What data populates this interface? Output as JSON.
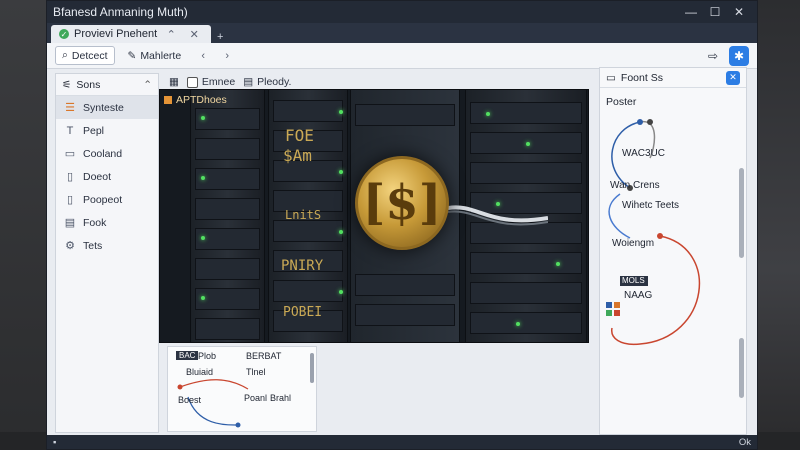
{
  "window": {
    "title": "Bfanesd Anmaning Muth)",
    "controls": [
      "—",
      "☐",
      "✕"
    ]
  },
  "tab": {
    "label": "Provievi Pnehent",
    "status_color": "#3fa85a"
  },
  "toolbar": {
    "btn1": "Detcect",
    "btn2": "Mahlerte"
  },
  "sidebar": {
    "header": "Sons",
    "items": [
      {
        "label": "Synteste",
        "icon": "list-icon"
      },
      {
        "label": "Pepl",
        "icon": "text-icon"
      },
      {
        "label": "Cooland",
        "icon": "box-icon"
      },
      {
        "label": "Doeot",
        "icon": "doc-icon"
      },
      {
        "label": "Poopeot",
        "icon": "doc-icon"
      },
      {
        "label": "Fook",
        "icon": "table-icon"
      },
      {
        "label": "Tets",
        "icon": "gear-icon"
      }
    ]
  },
  "center": {
    "tool1": "Emnee",
    "tool2": "Pleody.",
    "preview_label": "APTDhoes",
    "rack_texts": [
      "FOE",
      "$Am",
      "LnitS",
      "PNIRY",
      "POBEI"
    ],
    "coin_symbol": "[$]"
  },
  "mini": {
    "chip": "BAC",
    "t1": "Plob",
    "t2": "BERBAT",
    "t3": "Bluiaid",
    "t4": "Tlnel",
    "t5": "Boest",
    "t6": "Poanl",
    "t7": "Brahl"
  },
  "rpanel": {
    "title": "Foont Ss",
    "section": "Poster",
    "labels": [
      "WAC3UC",
      "Wan Crens",
      "Wihetc Teets",
      "Woiengm",
      "MOLS",
      "NAAG"
    ]
  },
  "status": {
    "right": "Ok"
  }
}
